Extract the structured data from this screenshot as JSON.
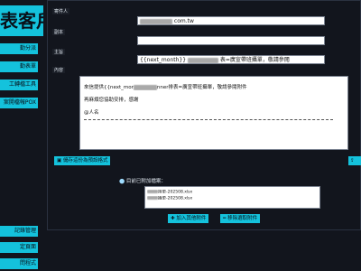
{
  "brand": {
    "label": "表客戶"
  },
  "nav": [
    {
      "label": "勤分派"
    },
    {
      "label": "勤表單"
    },
    {
      "label": "工轉檔工具"
    },
    {
      "label": "案開檔報POX"
    },
    {
      "label": "記錄管理"
    },
    {
      "label": "定頁面"
    },
    {
      "label": "問程式"
    }
  ],
  "form": {
    "sender_label": "寄件人",
    "recipient_label": "副本",
    "bcc_label": "主旨",
    "content_label": "內容",
    "sender_value": "com.tw",
    "subject_value": "{{next_month}}",
    "subject_tail": "表=廣宣帶班攝單，敬請參閱",
    "body_line1_prefix": "來信提供{{next_mor",
    "body_line1_suffix": "nner排表=廣宣帶班攝單，敬請參閱附件",
    "body_line2": "再麻煩您協助安排，感謝",
    "body_line3": "@人名"
  },
  "buttons": {
    "save_template": "儲存這份為預設格式",
    "add_attachment": "加入其他附件",
    "remove_attachment": "移除選取附件"
  },
  "attachments": {
    "title": "目前已附加檔案：",
    "files": [
      "排單-202508.xlsx",
      "攝單-202508.xlsx"
    ]
  }
}
